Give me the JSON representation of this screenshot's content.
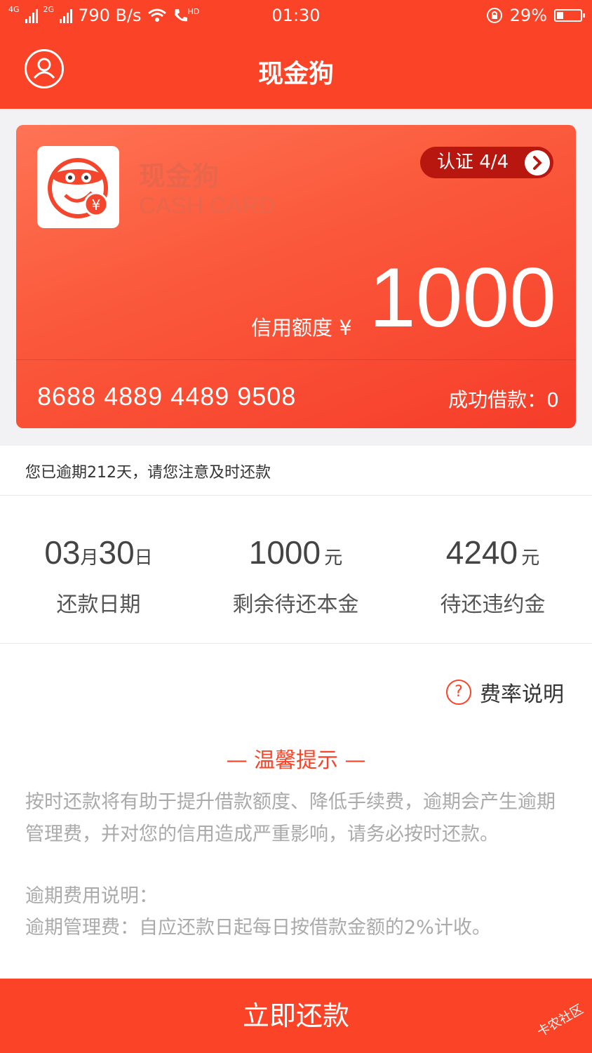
{
  "status_bar": {
    "net1": "4G",
    "net2": "2G",
    "speed": "790 B/s",
    "hd": "HD",
    "time": "01:30",
    "battery": "29%",
    "battery_level": 0.29
  },
  "header": {
    "title": "现金狗"
  },
  "card": {
    "brand_cn": "现金狗",
    "brand_en": "CASH CARD",
    "auth_label": "认证 4/4",
    "credit_label": "信用额度 ¥",
    "credit_value": "1000",
    "card_number": "8688 4889 4489 9508",
    "success_loans": "成功借款：0"
  },
  "notice": "您已逾期212天，请您注意及时还款",
  "stats": [
    {
      "value": "03",
      "mid": "月",
      "value2": "30",
      "unit": "日",
      "label": "还款日期"
    },
    {
      "value": "1000",
      "unit": "元",
      "label": "剩余待还本金"
    },
    {
      "value": "4240",
      "unit": "元",
      "label": "待还违约金"
    }
  ],
  "fee_link": "费率说明",
  "tip": {
    "title": "— 温馨提示 —",
    "p1": "按时还款将有助于提升借款额度、降低手续费，逾期会产生逾期管理费，并对您的信用造成严重影响，请务必按时还款。",
    "p2": "逾期费用说明：",
    "p3": "逾期管理费：自应还款日起每日按借款金额的2%计收。"
  },
  "cta": "立即还款",
  "watermark": "卡农社区",
  "colors": {
    "primary": "#fb4327",
    "pill": "#b8170f"
  }
}
